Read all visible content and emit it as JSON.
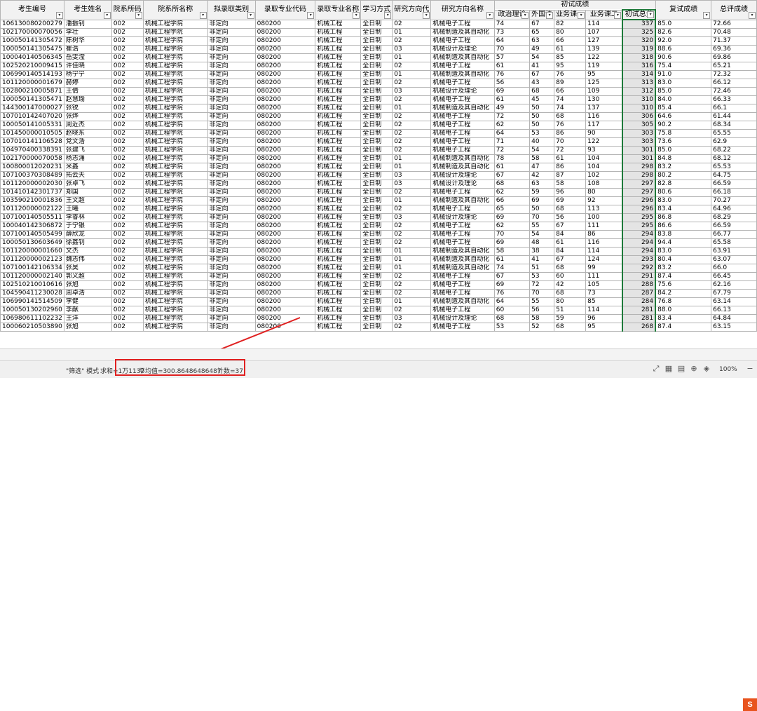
{
  "headers": {
    "exam_no": "考生编号",
    "name": "考生姓名",
    "dept_code": "院系所码",
    "dept_name": "院系所名称",
    "admit_type": "拟录取类别",
    "major_code": "录取专业代码",
    "major_name": "录取专业名称",
    "study_mode": "学习方式",
    "direction_code": "研究方向代",
    "direction_name": "研究方向名称",
    "initial_group": "初试成绩",
    "politics": "政治理论",
    "foreign": "外国语",
    "course1": "业务课一",
    "course2": "业务课二",
    "initial_total": "初试总分",
    "retest": "复试成绩",
    "overall": "总评成绩"
  },
  "rows": [
    [
      "106130080200279",
      "潘振钊",
      "002",
      "机械工程学院",
      "非定向",
      "080200",
      "机械工程",
      "全日制",
      "02",
      "机械电子工程",
      "74",
      "67",
      "82",
      "114",
      "337",
      "85.0",
      "72.66"
    ],
    [
      "102170000070056",
      "李壮",
      "002",
      "机械工程学院",
      "非定向",
      "080200",
      "机械工程",
      "全日制",
      "01",
      "机械制造及其自动化",
      "73",
      "65",
      "80",
      "107",
      "325",
      "82.6",
      "70.48"
    ],
    [
      "100050141305472",
      "陈树华",
      "002",
      "机械工程学院",
      "非定向",
      "080200",
      "机械工程",
      "全日制",
      "02",
      "机械电子工程",
      "64",
      "63",
      "66",
      "127",
      "320",
      "92.0",
      "71.37"
    ],
    [
      "100050141305475",
      "崔浩",
      "002",
      "机械工程学院",
      "非定向",
      "080200",
      "机械工程",
      "全日制",
      "03",
      "机械设计及理论",
      "70",
      "49",
      "61",
      "139",
      "319",
      "88.6",
      "69.36"
    ],
    [
      "100040140506345",
      "岳雯滢",
      "002",
      "机械工程学院",
      "非定向",
      "080200",
      "机械工程",
      "全日制",
      "01",
      "机械制造及其自动化",
      "57",
      "54",
      "85",
      "122",
      "318",
      "90.6",
      "69.86"
    ],
    [
      "102520210009415",
      "许佳晓",
      "002",
      "机械工程学院",
      "非定向",
      "080200",
      "机械工程",
      "全日制",
      "02",
      "机械电子工程",
      "61",
      "41",
      "95",
      "119",
      "316",
      "75.4",
      "65.21"
    ],
    [
      "106990140514193",
      "杨宁宁",
      "002",
      "机械工程学院",
      "非定向",
      "080200",
      "机械工程",
      "全日制",
      "01",
      "机械制造及其自动化",
      "76",
      "67",
      "76",
      "95",
      "314",
      "91.0",
      "72.32"
    ],
    [
      "101120000001679",
      "赫婷",
      "002",
      "机械工程学院",
      "非定向",
      "080200",
      "机械工程",
      "全日制",
      "02",
      "机械电子工程",
      "56",
      "43",
      "89",
      "125",
      "313",
      "83.0",
      "66.12"
    ],
    [
      "102800210005871",
      "王倩",
      "002",
      "机械工程学院",
      "非定向",
      "080200",
      "机械工程",
      "全日制",
      "03",
      "机械设计及理论",
      "69",
      "68",
      "66",
      "109",
      "312",
      "85.0",
      "72.46"
    ],
    [
      "100050141305471",
      "赵慧瑜",
      "002",
      "机械工程学院",
      "非定向",
      "080200",
      "机械工程",
      "全日制",
      "02",
      "机械电子工程",
      "61",
      "45",
      "74",
      "130",
      "310",
      "84.0",
      "66.33"
    ],
    [
      "144300147000027",
      "张锐",
      "002",
      "机械工程学院",
      "非定向",
      "080200",
      "机械工程",
      "全日制",
      "01",
      "机械制造及其自动化",
      "49",
      "50",
      "74",
      "137",
      "310",
      "85.4",
      "66.1"
    ],
    [
      "107010142407020",
      "张烨",
      "002",
      "机械工程学院",
      "非定向",
      "080200",
      "机械工程",
      "全日制",
      "02",
      "机械电子工程",
      "72",
      "50",
      "68",
      "116",
      "306",
      "64.6",
      "61.44"
    ],
    [
      "100050141005331",
      "周近杰",
      "002",
      "机械工程学院",
      "非定向",
      "080200",
      "机械工程",
      "全日制",
      "02",
      "机械电子工程",
      "62",
      "50",
      "76",
      "117",
      "305",
      "90.2",
      "68.34"
    ],
    [
      "101450000010505",
      "赵晓东",
      "002",
      "机械工程学院",
      "非定向",
      "080200",
      "机械工程",
      "全日制",
      "02",
      "机械电子工程",
      "64",
      "53",
      "86",
      "90",
      "303",
      "75.8",
      "65.55"
    ],
    [
      "107010141106528",
      "党文浩",
      "002",
      "机械工程学院",
      "非定向",
      "080200",
      "机械工程",
      "全日制",
      "02",
      "机械电子工程",
      "71",
      "40",
      "70",
      "122",
      "303",
      "73.6",
      "62.9"
    ],
    [
      "104970400338391",
      "张建飞",
      "002",
      "机械工程学院",
      "非定向",
      "080200",
      "机械工程",
      "全日制",
      "02",
      "机械电子工程",
      "72",
      "54",
      "72",
      "93",
      "301",
      "85.0",
      "68.22"
    ],
    [
      "102170000070058",
      "杨志涌",
      "002",
      "机械工程学院",
      "非定向",
      "080200",
      "机械工程",
      "全日制",
      "01",
      "机械制造及其自动化",
      "78",
      "58",
      "61",
      "104",
      "301",
      "84.8",
      "68.12"
    ],
    [
      "100800012020231",
      "米鑫",
      "002",
      "机械工程学院",
      "非定向",
      "080200",
      "机械工程",
      "全日制",
      "01",
      "机械制造及其自动化",
      "61",
      "47",
      "86",
      "104",
      "298",
      "83.2",
      "65.53"
    ],
    [
      "107100370308489",
      "拓云天",
      "002",
      "机械工程学院",
      "非定向",
      "080200",
      "机械工程",
      "全日制",
      "03",
      "机械设计及理论",
      "67",
      "42",
      "87",
      "102",
      "298",
      "80.2",
      "64.75"
    ],
    [
      "101120000002030",
      "张卓飞",
      "002",
      "机械工程学院",
      "非定向",
      "080200",
      "机械工程",
      "全日制",
      "03",
      "机械设计及理论",
      "68",
      "63",
      "58",
      "108",
      "297",
      "82.8",
      "66.59"
    ],
    [
      "101410142301737",
      "郑国",
      "002",
      "机械工程学院",
      "非定向",
      "080200",
      "机械工程",
      "全日制",
      "02",
      "机械电子工程",
      "62",
      "59",
      "96",
      "80",
      "297",
      "80.6",
      "66.18"
    ],
    [
      "103590210001836",
      "王文超",
      "002",
      "机械工程学院",
      "非定向",
      "080200",
      "机械工程",
      "全日制",
      "01",
      "机械制造及其自动化",
      "66",
      "69",
      "69",
      "92",
      "296",
      "83.0",
      "70.27"
    ],
    [
      "101120000002122",
      "王曦",
      "002",
      "机械工程学院",
      "非定向",
      "080200",
      "机械工程",
      "全日制",
      "02",
      "机械电子工程",
      "65",
      "50",
      "68",
      "113",
      "296",
      "83.4",
      "64.96"
    ],
    [
      "107100140505511",
      "李睿林",
      "002",
      "机械工程学院",
      "非定向",
      "080200",
      "机械工程",
      "全日制",
      "03",
      "机械设计及理论",
      "69",
      "70",
      "56",
      "100",
      "295",
      "86.8",
      "68.29"
    ],
    [
      "100040142306872",
      "于宁银",
      "002",
      "机械工程学院",
      "非定向",
      "080200",
      "机械工程",
      "全日制",
      "02",
      "机械电子工程",
      "62",
      "55",
      "67",
      "111",
      "295",
      "86.6",
      "66.59"
    ],
    [
      "107100140505499",
      "薛欣龙",
      "002",
      "机械工程学院",
      "非定向",
      "080200",
      "机械工程",
      "全日制",
      "02",
      "机械电子工程",
      "70",
      "54",
      "84",
      "86",
      "294",
      "83.8",
      "66.77"
    ],
    [
      "100050130603649",
      "徐鑫钊",
      "002",
      "机械工程学院",
      "非定向",
      "080200",
      "机械工程",
      "全日制",
      "02",
      "机械电子工程",
      "69",
      "48",
      "61",
      "116",
      "294",
      "94.4",
      "65.58"
    ],
    [
      "101120000001660",
      "文杰",
      "002",
      "机械工程学院",
      "非定向",
      "080200",
      "机械工程",
      "全日制",
      "01",
      "机械制造及其自动化",
      "58",
      "38",
      "84",
      "114",
      "294",
      "83.0",
      "63.91"
    ],
    [
      "101120000002123",
      "魏志伟",
      "002",
      "机械工程学院",
      "非定向",
      "080200",
      "机械工程",
      "全日制",
      "01",
      "机械制造及其自动化",
      "61",
      "41",
      "67",
      "124",
      "293",
      "80.4",
      "63.07"
    ],
    [
      "107100142106334",
      "张昊",
      "002",
      "机械工程学院",
      "非定向",
      "080200",
      "机械工程",
      "全日制",
      "01",
      "机械制造及其自动化",
      "74",
      "51",
      "68",
      "99",
      "292",
      "83.2",
      "66.0"
    ],
    [
      "101120000002140",
      "郭义超",
      "002",
      "机械工程学院",
      "非定向",
      "080200",
      "机械工程",
      "全日制",
      "02",
      "机械电子工程",
      "67",
      "53",
      "60",
      "111",
      "291",
      "87.4",
      "66.45"
    ],
    [
      "102510210010616",
      "张旭",
      "002",
      "机械工程学院",
      "非定向",
      "080200",
      "机械工程",
      "全日制",
      "02",
      "机械电子工程",
      "69",
      "72",
      "42",
      "105",
      "288",
      "75.6",
      "62.16"
    ],
    [
      "104590411230028",
      "周卓浩",
      "002",
      "机械工程学院",
      "非定向",
      "080200",
      "机械工程",
      "全日制",
      "02",
      "机械电子工程",
      "76",
      "70",
      "68",
      "73",
      "287",
      "84.2",
      "67.79"
    ],
    [
      "106990141514509",
      "李健",
      "002",
      "机械工程学院",
      "非定向",
      "080200",
      "机械工程",
      "全日制",
      "01",
      "机械制造及其自动化",
      "64",
      "55",
      "80",
      "85",
      "284",
      "76.8",
      "63.14"
    ],
    [
      "100050130202960",
      "李猷",
      "002",
      "机械工程学院",
      "非定向",
      "080200",
      "机械工程",
      "全日制",
      "02",
      "机械电子工程",
      "60",
      "56",
      "51",
      "114",
      "281",
      "88.0",
      "66.13"
    ],
    [
      "106980611102232",
      "王洋",
      "002",
      "机械工程学院",
      "非定向",
      "080200",
      "机械工程",
      "全日制",
      "03",
      "机械设计及理论",
      "68",
      "58",
      "59",
      "96",
      "281",
      "83.4",
      "64.84"
    ],
    [
      "100060210503890",
      "张旭",
      "002",
      "机械工程学院",
      "非定向",
      "080200",
      "机械工程",
      "全日制",
      "02",
      "机械电子工程",
      "53",
      "52",
      "68",
      "95",
      "268",
      "87.4",
      "63.15"
    ]
  ],
  "status": {
    "mode": "\"筛选\" 模式",
    "sum": "求和=1万1132",
    "average": "平均值=300.86486486487",
    "count": "计数=37",
    "zoom": "100%"
  },
  "annotation_color": "#e02020",
  "selection_color": "#1f7a3a"
}
